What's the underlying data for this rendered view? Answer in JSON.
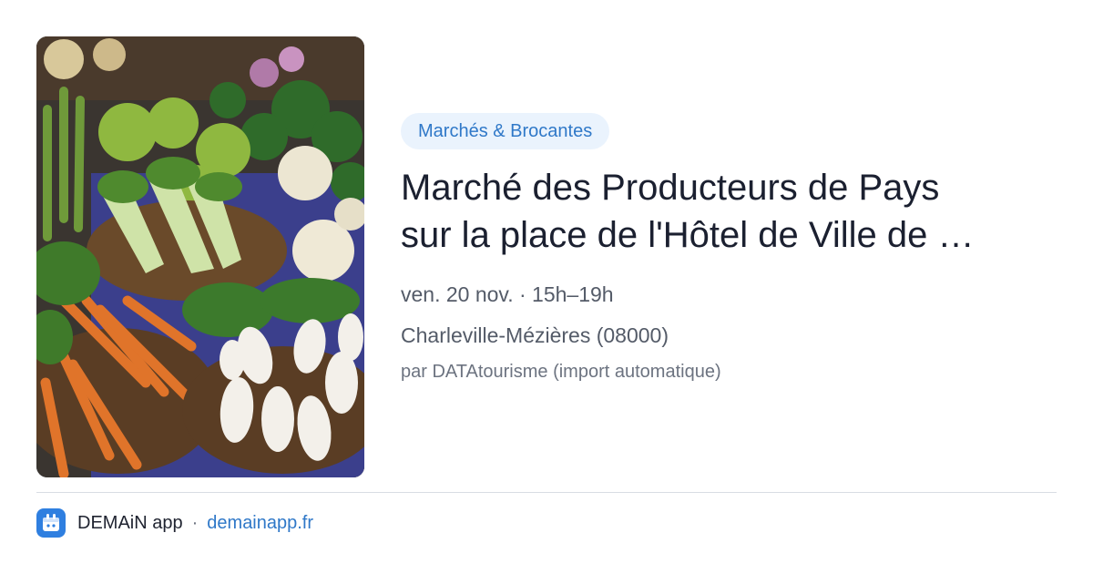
{
  "event": {
    "category": "Marchés & Brocantes",
    "title_line1": "Marché des Producteurs de Pays",
    "title_line2": "sur la place de l'Hôtel de Ville de …",
    "datetime": "ven. 20 nov. · 15h–19h",
    "location": "Charleville-Mézières (08000)",
    "source": "par DATAtourisme (import automatique)",
    "image_icon": "vegetable-market-photo"
  },
  "footer": {
    "app_icon": "demain-app-icon",
    "app_name": "DEMAiN app",
    "separator": "·",
    "url": "demainapp.fr"
  },
  "colors": {
    "tag_bg": "#eaf3fd",
    "tag_text": "#2f78c8",
    "link": "#2f78c8",
    "brand": "#2f7fe0"
  }
}
